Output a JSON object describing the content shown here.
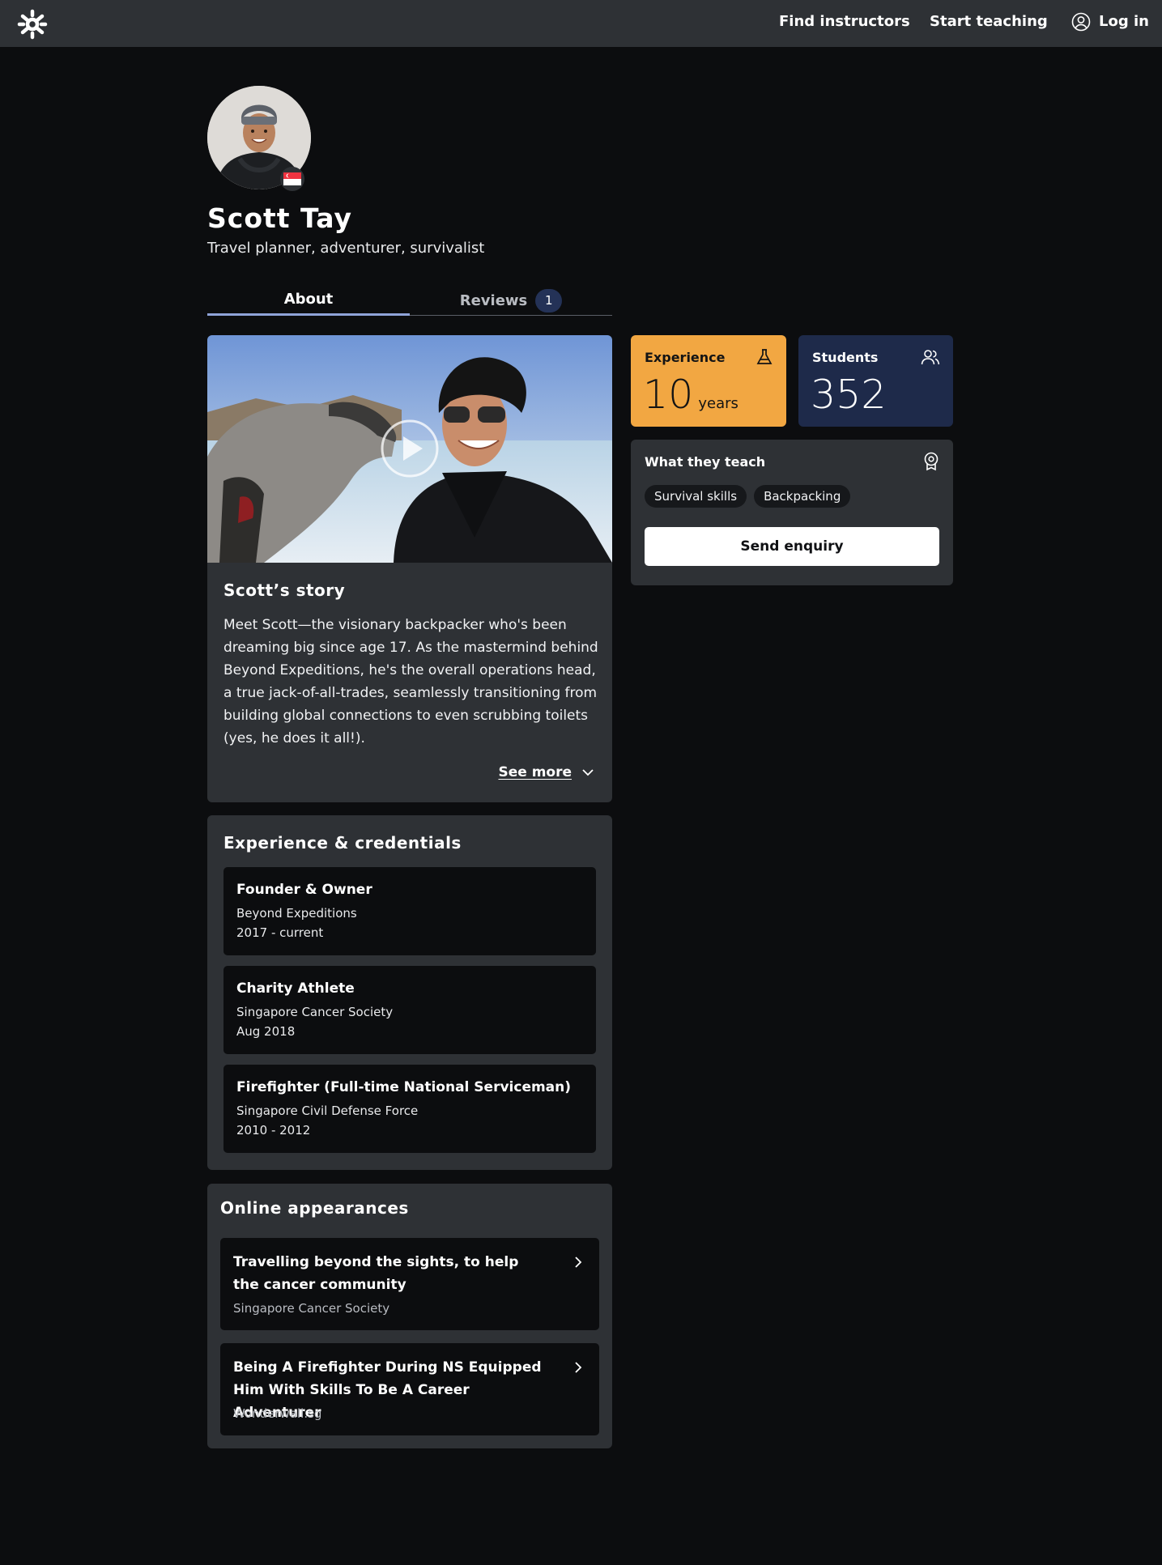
{
  "nav": {
    "find_instructors": "Find instructors",
    "start_teaching": "Start teaching",
    "log_in": "Log in"
  },
  "profile": {
    "name": "Scott Tay",
    "tagline": "Travel planner, adventurer, survivalist"
  },
  "tabs": [
    {
      "label": "About",
      "active": true
    },
    {
      "label": "Reviews",
      "count": "1",
      "active": false
    }
  ],
  "story": {
    "title": "Scott’s story",
    "text": "Meet Scott—the visionary backpacker who's been dreaming big since age 17. As the mastermind behind Beyond Expeditions, he's the overall operations head, a true jack-of-all-trades, seamlessly transitioning from building global connections to even scrubbing toilets (yes, he does it all!).",
    "see_more": "See more"
  },
  "stats": {
    "experience": {
      "label": "Experience",
      "value": "10",
      "unit": "years",
      "icon": "flask-icon",
      "color": "#f2a742"
    },
    "students": {
      "label": "Students",
      "value": "352",
      "icon": "users-icon",
      "color": "#1e2a4a"
    }
  },
  "teach": {
    "title": "What they teach",
    "icon": "award-icon",
    "topics": [
      "Survival skills",
      "Backpacking"
    ],
    "cta": "Send enquiry"
  },
  "experience": {
    "title": "Experience & credentials",
    "items": [
      {
        "role": "Founder & Owner",
        "org": "Beyond Expeditions",
        "dates": "2017 - current"
      },
      {
        "role": "Charity Athlete",
        "org": "Singapore Cancer Society",
        "dates": "Aug 2018"
      },
      {
        "role": "Firefighter (Full-time National Serviceman)",
        "org": "Singapore Civil Defense Force",
        "dates": "2010 - 2012"
      }
    ]
  },
  "appearances": {
    "title": "Online appearances",
    "items": [
      {
        "title": "Travelling beyond the sights, to help the cancer community",
        "source": "Singapore Cancer Society"
      },
      {
        "title": "Being A Firefighter During NS Equipped Him With Skills To Be A Career Adventurer",
        "source": "Wonderwall.sg"
      }
    ]
  },
  "theme": {
    "background": "#0c0d0f",
    "surface": "#2e3135",
    "accent": "#8fa3d8"
  }
}
